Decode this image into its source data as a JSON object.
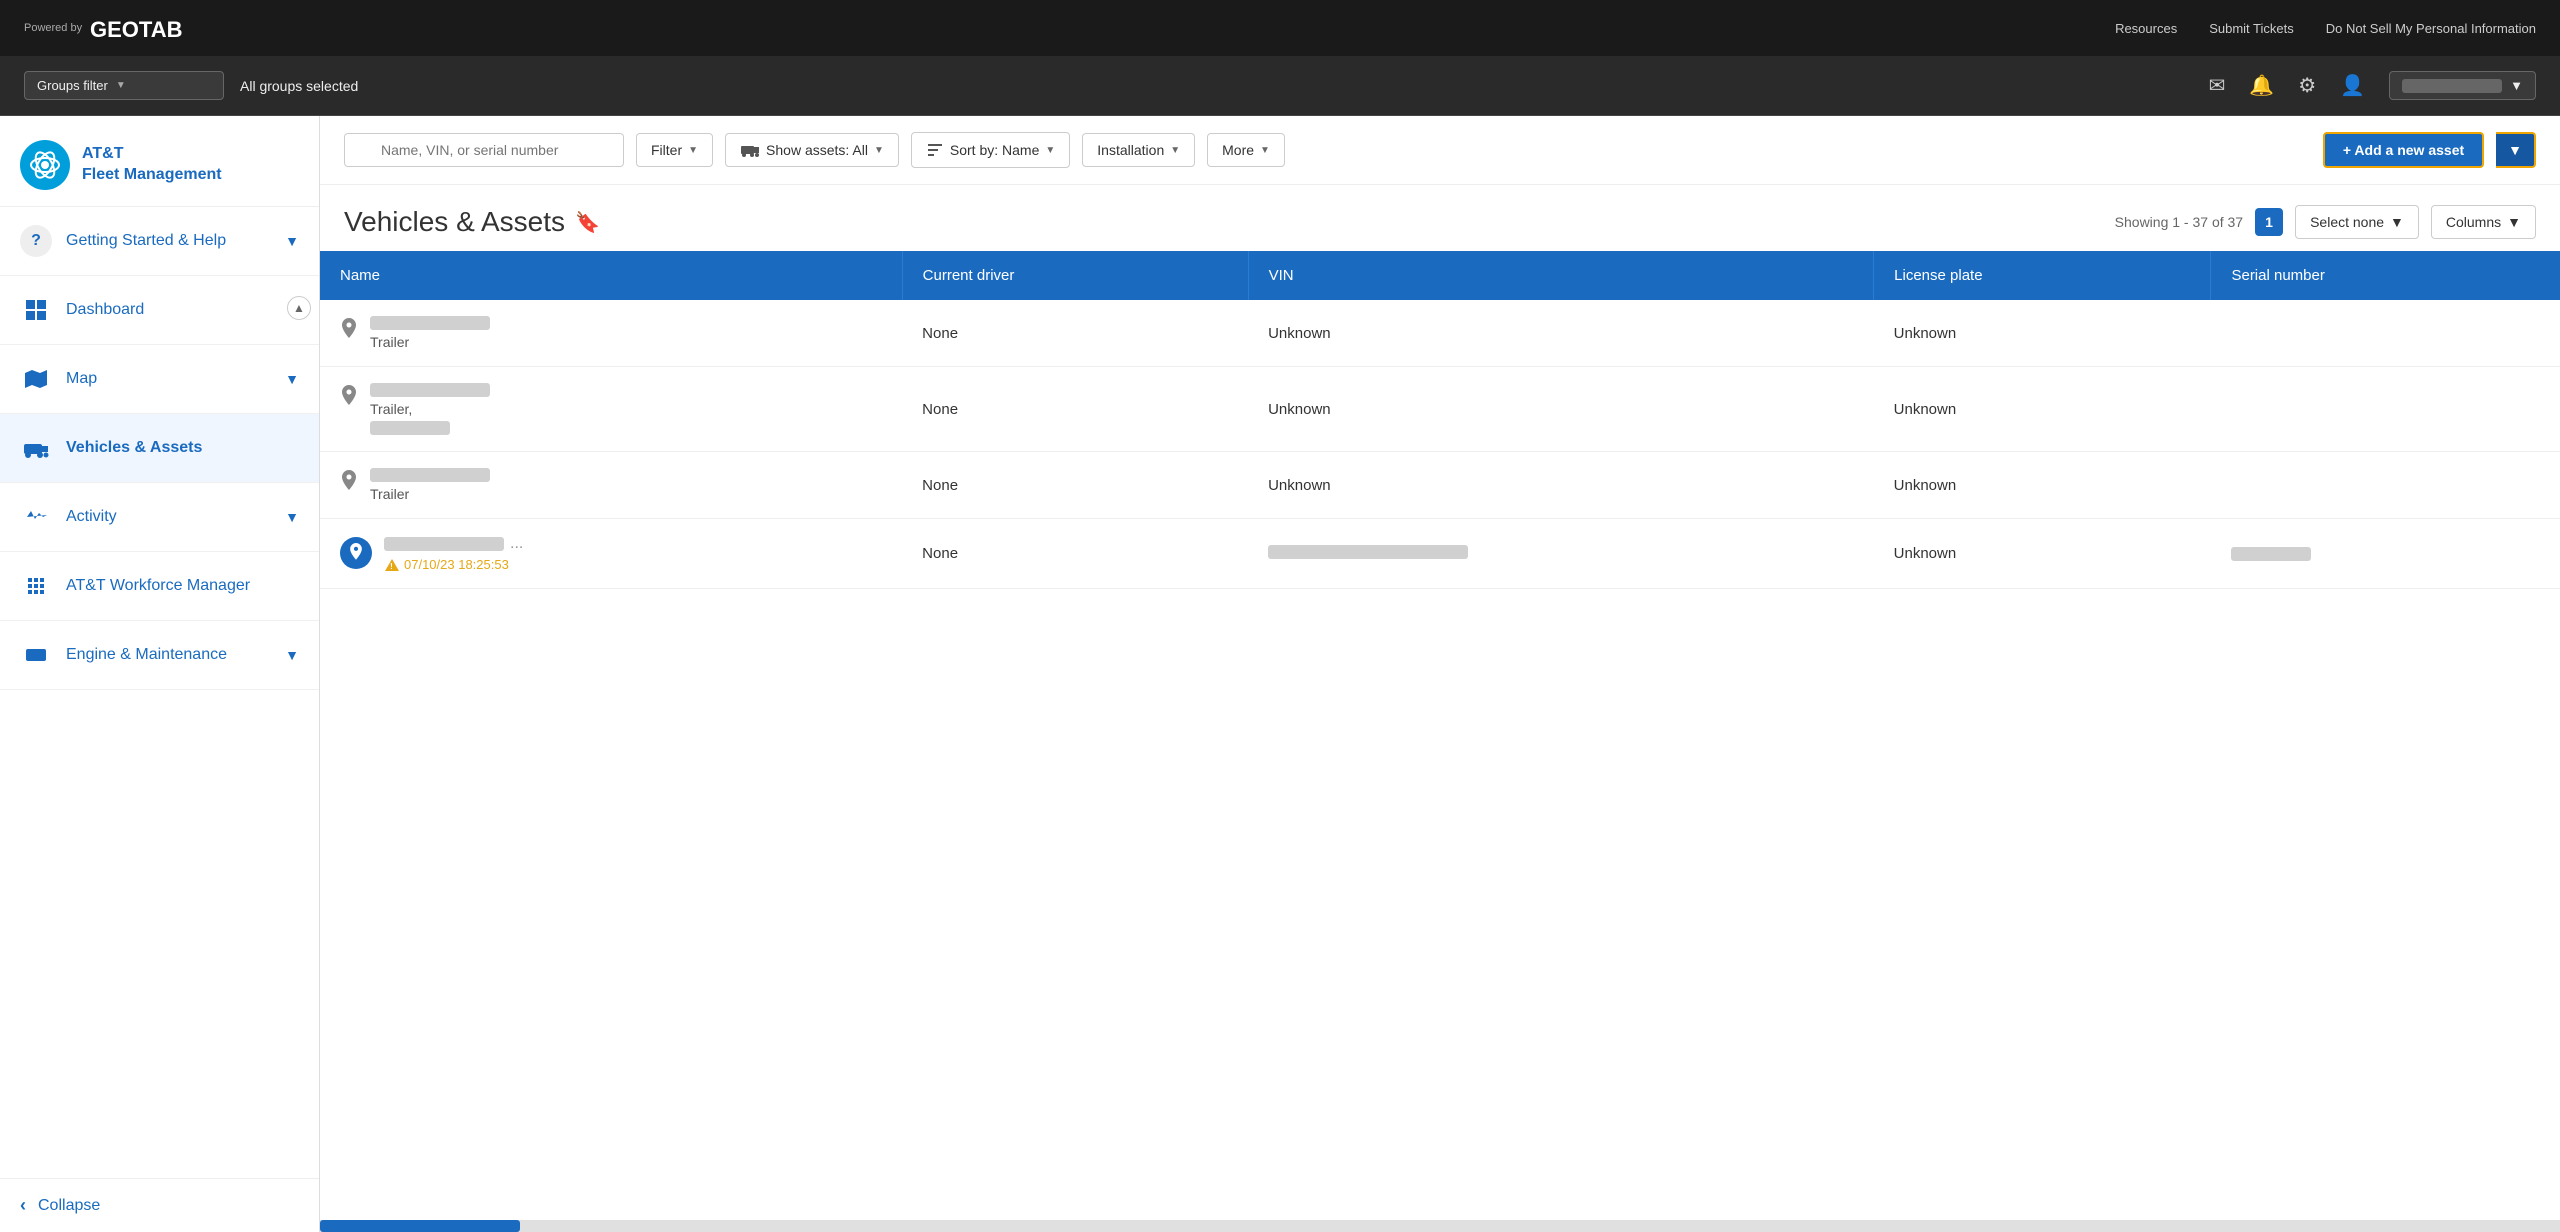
{
  "topbar": {
    "powered_by": "Powered\nby",
    "logo_text": "GEOTAB",
    "resources": "Resources",
    "submit_tickets": "Submit Tickets",
    "do_not_sell": "Do Not Sell My Personal Information"
  },
  "filterbar": {
    "groups_filter_label": "Groups filter",
    "groups_filter_dropdown_icon": "▼",
    "all_groups_selected": "All groups selected",
    "mail_icon": "✉",
    "bell_icon": "🔔",
    "gear_icon": "⚙",
    "user_icon": "👤",
    "user_menu_arrow": "▼"
  },
  "sidebar": {
    "logo_initials": "AT&T",
    "app_name": "AT&T\nFleet Management",
    "nav_items": [
      {
        "id": "getting-started",
        "label": "Getting Started & Help",
        "icon": "?",
        "has_chevron": true
      },
      {
        "id": "dashboard",
        "label": "Dashboard",
        "icon": "📊",
        "has_chevron": false
      },
      {
        "id": "map",
        "label": "Map",
        "icon": "🗺",
        "has_chevron": true
      },
      {
        "id": "vehicles-assets",
        "label": "Vehicles & Assets",
        "icon": "🚚",
        "has_chevron": false,
        "active": true
      },
      {
        "id": "activity",
        "label": "Activity",
        "icon": "📈",
        "has_chevron": true
      },
      {
        "id": "att-workforce",
        "label": "AT&T Workforce Manager",
        "icon": "🧩",
        "has_chevron": false
      },
      {
        "id": "engine-maintenance",
        "label": "Engine & Maintenance",
        "icon": "🎬",
        "has_chevron": true
      }
    ],
    "collapse_label": "Collapse",
    "collapse_icon": "‹"
  },
  "toolbar": {
    "search_placeholder": "Name, VIN, or serial number",
    "filter_label": "Filter",
    "show_assets_label": "Show assets:",
    "show_assets_value": "All",
    "sort_by_label": "Sort by:",
    "sort_by_value": "Name",
    "installation_label": "Installation",
    "more_label": "More",
    "add_asset_label": "+ Add a new asset"
  },
  "page_header": {
    "title": "Vehicles & Assets",
    "bookmark_icon": "🔖",
    "showing_text": "Showing 1 - 37 of 37",
    "page_number": "1",
    "select_none_label": "Select none",
    "columns_label": "Columns"
  },
  "table": {
    "columns": [
      "Name",
      "Current driver",
      "VIN",
      "License plate",
      "Serial number"
    ],
    "rows": [
      {
        "name_blurred": true,
        "name_suffix": "Trailer",
        "name_extra": "",
        "icon_type": "pin",
        "driver": "None",
        "vin": "Unknown",
        "license_plate": "Unknown",
        "serial": "",
        "has_warning": false,
        "active_icon": false
      },
      {
        "name_blurred": true,
        "name_suffix": "Trailer,",
        "name_extra": "",
        "icon_type": "pin",
        "driver": "None",
        "vin": "Unknown",
        "license_plate": "Unknown",
        "serial": "",
        "has_warning": false,
        "active_icon": false
      },
      {
        "name_blurred": true,
        "name_suffix": "Trailer",
        "name_extra": "",
        "icon_type": "pin",
        "driver": "None",
        "vin": "Unknown",
        "license_plate": "Unknown",
        "serial": "",
        "has_warning": false,
        "active_icon": false
      },
      {
        "name_blurred": true,
        "name_suffix": "...",
        "name_extra": "07/10/23 18:25:53",
        "icon_type": "active-pin",
        "driver": "None",
        "vin_blurred": true,
        "license_plate": "Unknown",
        "serial_blurred": true,
        "has_warning": true,
        "active_icon": true
      }
    ]
  }
}
